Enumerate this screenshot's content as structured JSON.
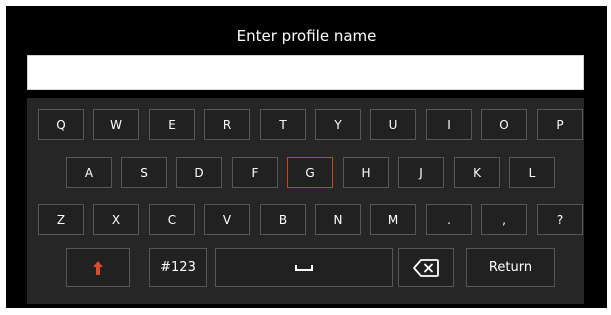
{
  "dialog": {
    "title": "Enter profile name"
  },
  "input": {
    "value": "",
    "placeholder": ""
  },
  "keyboard": {
    "row1": [
      "Q",
      "W",
      "E",
      "R",
      "T",
      "Y",
      "U",
      "I",
      "O",
      "P"
    ],
    "row2": [
      "A",
      "S",
      "D",
      "F",
      "G",
      "H",
      "J",
      "K",
      "L"
    ],
    "row3": [
      "Z",
      "X",
      "C",
      "V",
      "B",
      "N",
      "M",
      ".",
      ",",
      "?"
    ],
    "selected_key": "G",
    "symbols_label": "#123",
    "return_label": "Return"
  },
  "icons": {
    "shift": "shift-up-arrow-icon",
    "space": "space-bar-icon",
    "backspace": "backspace-icon"
  },
  "colors": {
    "background": "#000000",
    "keyboard": "#262626",
    "key_border": "#575757",
    "selected_border": "#d04020",
    "shift_arrow": "#e04a2a"
  }
}
